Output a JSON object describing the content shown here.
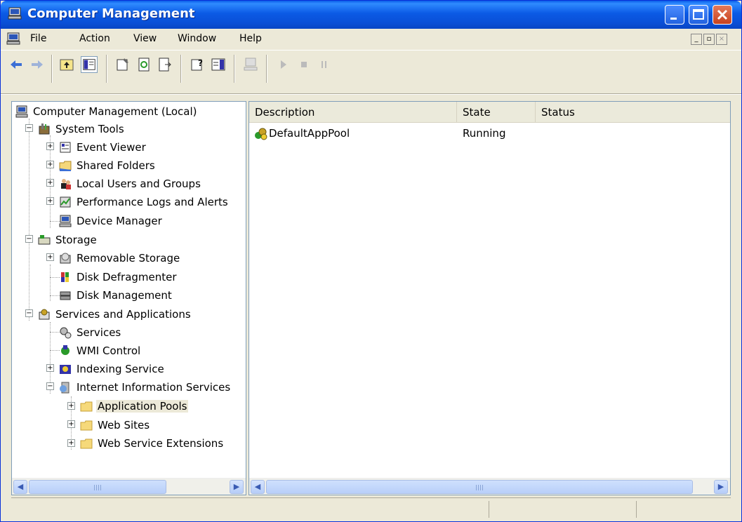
{
  "window": {
    "title": "Computer Management"
  },
  "menu": {
    "items": [
      "File",
      "Action",
      "View",
      "Window",
      "Help"
    ]
  },
  "toolbar": {
    "buttons": [
      "back-icon",
      "forward-icon",
      "up-one-level-icon",
      "show-hide-console-tree-icon",
      "properties-icon",
      "refresh-icon",
      "export-list-icon",
      "help-icon",
      "show-hide-action-pane-icon",
      "connect-computer-icon",
      "start-icon",
      "stop-icon",
      "pause-icon"
    ]
  },
  "tree": {
    "root": "Computer Management (Local)",
    "system_tools": "System Tools",
    "event_viewer": "Event Viewer",
    "shared_folders": "Shared Folders",
    "local_users": "Local Users and Groups",
    "perf_logs": "Performance Logs and Alerts",
    "device_manager": "Device Manager",
    "storage": "Storage",
    "removable_storage": "Removable Storage",
    "disk_defrag": "Disk Defragmenter",
    "disk_mgmt": "Disk Management",
    "services_apps": "Services and Applications",
    "services": "Services",
    "wmi": "WMI Control",
    "indexing": "Indexing Service",
    "iis": "Internet Information Services",
    "app_pools": "Application Pools",
    "web_sites": "Web Sites",
    "web_ext": "Web Service Extensions"
  },
  "list": {
    "columns": [
      "Description",
      "State",
      "Status"
    ],
    "rows": [
      {
        "description": "DefaultAppPool",
        "state": "Running",
        "status": ""
      }
    ]
  },
  "colors": {
    "title_blue": "#0a5ce8",
    "chrome": "#ece9d8",
    "selection": "#ece9d8"
  }
}
